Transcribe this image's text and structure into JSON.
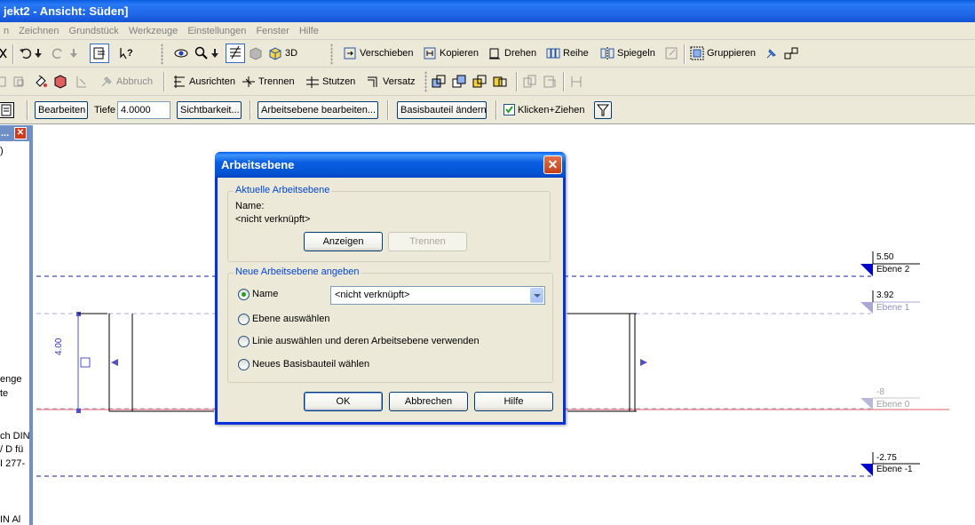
{
  "window": {
    "title": "jekt2 - Ansicht: Süden]"
  },
  "menu": [
    "n",
    "Zeichnen",
    "Grundstück",
    "Werkzeuge",
    "Einstellungen",
    "Fenster",
    "Hilfe"
  ],
  "toolbar1": {
    "view_3d": "3D",
    "verschieben": "Verschieben",
    "kopieren": "Kopieren",
    "drehen": "Drehen",
    "reihe": "Reihe",
    "spiegeln": "Spiegeln",
    "gruppieren": "Gruppieren"
  },
  "toolbar2": {
    "abbruch": "Abbruch",
    "ausrichten": "Ausrichten",
    "trennen": "Trennen",
    "stutzen": "Stutzen",
    "versatz": "Versatz"
  },
  "toolbar3": {
    "bearbeiten": "Bearbeiten",
    "tiefe_label": "Tiefe",
    "tiefe_value": "4.0000",
    "sichtbarkeit": "Sichtbarkeit...",
    "arbeitsebene_bearbeiten": "Arbeitsebene bearbeiten...",
    "basisbauteil_aendern": "Basisbauteil ändern",
    "klicken_ziehen": "Klicken+Ziehen",
    "klicken_ziehen_checked": true
  },
  "left_panel": {
    "header": "...",
    "lines": [
      ")",
      "enge",
      "te",
      "ch DIN",
      "/ D fü",
      "I 277-",
      "IN Al"
    ]
  },
  "canvas": {
    "levels": [
      {
        "value": "5.50",
        "name": "Ebene 2"
      },
      {
        "value": "3.92",
        "name": "Ebene 1"
      },
      {
        "value": "-8",
        "name": "Ebene 0"
      },
      {
        "value": "-2.75",
        "name": "Ebene -1"
      }
    ],
    "dimension": "4.00"
  },
  "dialog": {
    "title": "Arbeitsebene",
    "group_current": "Aktuelle Arbeitsebene",
    "name_label": "Name:",
    "name_value": "<nicht verknüpft>",
    "btn_anzeigen": "Anzeigen",
    "btn_trennen": "Trennen",
    "group_new": "Neue Arbeitsebene angeben",
    "radio_name": "Name",
    "combo_value": "<nicht verknüpft>",
    "radio_ebene": "Ebene auswählen",
    "radio_linie": "Linie auswählen und deren Arbeitsebene verwenden",
    "radio_basis": "Neues Basisbauteil wählen",
    "selected_option": "Name",
    "btn_ok": "OK",
    "btn_abbrechen": "Abbrechen",
    "btn_hilfe": "Hilfe"
  },
  "colors": {
    "title_blue": "#1d63e6",
    "level_marker": "#0000cc",
    "ground_line": "#e06060",
    "panel_blue": "#6f8fc7"
  }
}
